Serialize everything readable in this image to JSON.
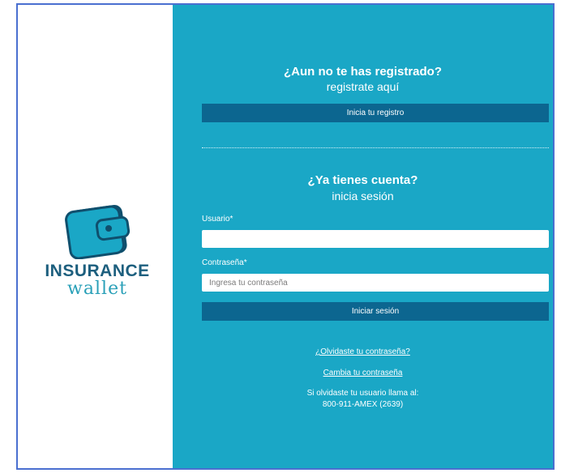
{
  "brand": {
    "name_line1": "INSURANCE",
    "name_line2": "wallet",
    "logo_icon": "wallet-icon",
    "colors": {
      "primary_dark": "#1d5f7e",
      "accent": "#2aa0b8",
      "panel_bg": "#1aa7c6",
      "button_bg": "#0c6690"
    }
  },
  "register": {
    "title": "¿Aun no te has registrado?",
    "subtitle": "registrate aquí",
    "button_label": "Inicia tu registro"
  },
  "login": {
    "title": "¿Ya tienes cuenta?",
    "subtitle": "inicia sesión",
    "username_label": "Usuario*",
    "username_value": "",
    "password_label": "Contraseña*",
    "password_placeholder": "Ingresa tu contraseña",
    "submit_label": "Iniciar sesión"
  },
  "links": {
    "forgot_password": "¿Olvidaste tu contraseña?",
    "change_password": "Cambia tu contraseña"
  },
  "help": {
    "line1": "Si olvidaste tu usuario llama al:",
    "line2": "800-911-AMEX (2639)"
  }
}
